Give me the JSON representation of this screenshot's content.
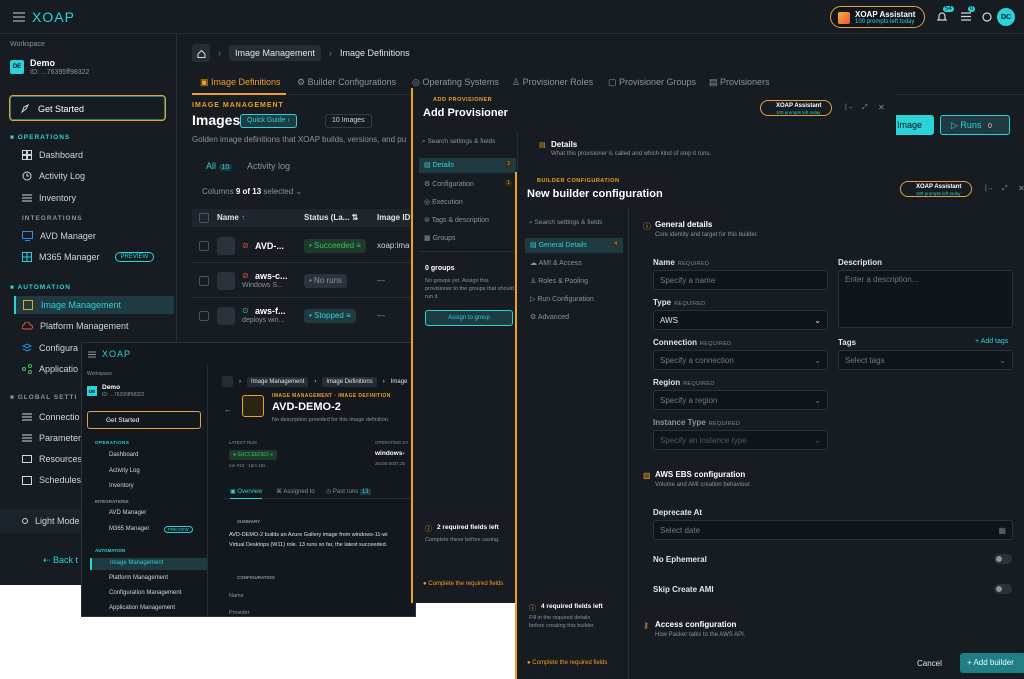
{
  "app": {
    "logo": "XOAP"
  },
  "assistant": {
    "title": "XOAP Assistant",
    "subtitle": "100 prompts left today",
    "notif": "54",
    "tasks": "0",
    "avatar": "DC"
  },
  "workspace": {
    "label": "Workspace",
    "name": "Demo",
    "badge": "DE",
    "id": "ID: ...76395ff98322"
  },
  "sidebar": {
    "get_started": "Get Started",
    "operations": "OPERATIONS",
    "dashboard": "Dashboard",
    "activity": "Activity Log",
    "inventory": "Inventory",
    "integrations": "INTEGRATIONS",
    "avd": "AVD Manager",
    "m365": "M365 Manager",
    "preview": "PREVIEW",
    "automation": "AUTOMATION",
    "image_mgmt": "Image Management",
    "platform": "Platform Management",
    "config_trunc": "Configura",
    "config": "Configuration Management",
    "app_trunc": "Applicatio",
    "app": "Application Management",
    "global": "GLOBAL SETTI",
    "connections": "Connectio",
    "parameters": "Parameter",
    "resources": "Resources",
    "schedules": "Schedules",
    "light_mode": "Light Mode",
    "back": "Back t"
  },
  "breadcrumb": {
    "home": "",
    "image_mgmt": "Image Management",
    "image_defs": "Image Definitions"
  },
  "tabs": [
    "Image Definitions",
    "Builder Configurations",
    "Operating Systems",
    "Provisioner Roles",
    "Provisioner Groups",
    "Provisioners"
  ],
  "page": {
    "kicker": "IMAGE MANAGEMENT",
    "title": "Images",
    "quick_guide": "Quick Guide",
    "count": "10 Images",
    "desc": "Golden image definitions that XOAP builds, versions, and pu",
    "new_image": "w Image",
    "runs": "Runs",
    "runs_count": "0"
  },
  "filters": {
    "all": "All",
    "all_count": "10",
    "activity": "Activity log",
    "columns": "Columns",
    "columns_sel": "9 of 13",
    "selected": "selected"
  },
  "table": {
    "headers": [
      "Name",
      "Status (La...",
      "Image ID"
    ],
    "rows": [
      {
        "name": "AVD-...",
        "sub": "",
        "status": "Succeeded",
        "imgid": "xoap:ima"
      },
      {
        "name": "aws-c...",
        "sub": "Windows S...",
        "status": "No runs",
        "imgid": "—"
      },
      {
        "name": "aws-f...",
        "sub": "deploys win...",
        "status": "Stopped",
        "imgid": "—"
      }
    ]
  },
  "detail": {
    "kicker": "IMAGE MANAGEMENT · IMAGE DEFINITION",
    "title": "AVD-DEMO-2",
    "desc": "No description provided for this image definition.",
    "bc1": "Image Management",
    "bc2": "Image Definitions",
    "bc3": "Image",
    "latest_run": "LATEST RUN",
    "status": "SUCCEEDED",
    "run_meta": "run #13 · 16m 15s",
    "os_label": "OPERATING SY",
    "os_value": "windows-",
    "os_ver": "26100.6037.25",
    "tab_overview": "Overview",
    "tab_assigned": "Assigned to",
    "tab_past": "Past runs",
    "past_count": "13",
    "summary": "SUMMARY",
    "summary_text1": "AVD-DEMO-2 builds an Azure Gallery image from windows-11-wi",
    "summary_text2": "Virtual Desktops (W11) role. 13 runs so far, the latest succeeded.",
    "config": "CONFIGURATION",
    "name": "Name",
    "provider": "Provider"
  },
  "provisioner": {
    "kicker": "ADD PROVISIONER",
    "title": "Add Provisioner",
    "search": "Search settings & fields",
    "nav": [
      "Details",
      "Configuration",
      "Execution",
      "Tags & description",
      "Groups"
    ],
    "nav_badges": [
      "2",
      "1",
      "",
      "",
      ""
    ],
    "groups_title": "0 groups",
    "groups_text": "No groups yet. Assign this provisioner to the groups that should run it.",
    "assign": "Assign to group",
    "req_title": "2 required fields left",
    "req_text": "Complete these before saving.",
    "complete": "Complete the required fields",
    "details_title": "Details",
    "details_desc": "What this provisioner is called and which kind of step it runs."
  },
  "builder": {
    "kicker": "BUILDER CONFIGURATION",
    "title": "New builder configuration",
    "search": "Search settings & fields",
    "nav": [
      "General Details",
      "AMI & Access",
      "Roles & Pooling",
      "Run Configuration",
      "Advanced"
    ],
    "nav_badge": "4",
    "general_title": "General details",
    "general_desc": "Core identity and target for this builder.",
    "name_label": "Name",
    "name_ph": "Specify a name",
    "required": "REQUIRED",
    "desc_label": "Description",
    "desc_ph": "Enter a description...",
    "type_label": "Type",
    "type_value": "AWS",
    "conn_label": "Connection",
    "conn_ph": "Specify a connection",
    "tags_label": "Tags",
    "add_tags": "+ Add tags",
    "tags_ph": "Select tags",
    "region_label": "Region",
    "region_ph": "Specify a region",
    "inst_label": "Instance Type",
    "inst_ph": "Specify an instance type",
    "ebs_title": "AWS EBS configuration",
    "ebs_desc": "Volume and AMI creation behaviour.",
    "deprecate_label": "Deprecate At",
    "deprecate_ph": "Select date",
    "no_eph": "No Ephemeral",
    "skip_ami": "Skip Create AMI",
    "access_title": "Access configuration",
    "access_desc": "How Packer talks to the AWS API.",
    "req_title": "4 required fields left",
    "req_text1": "Fill in the required details",
    "req_text2": "before creating this builder.",
    "complete": "Complete the required fields",
    "cancel": "Cancel",
    "add": "+ Add builder"
  }
}
